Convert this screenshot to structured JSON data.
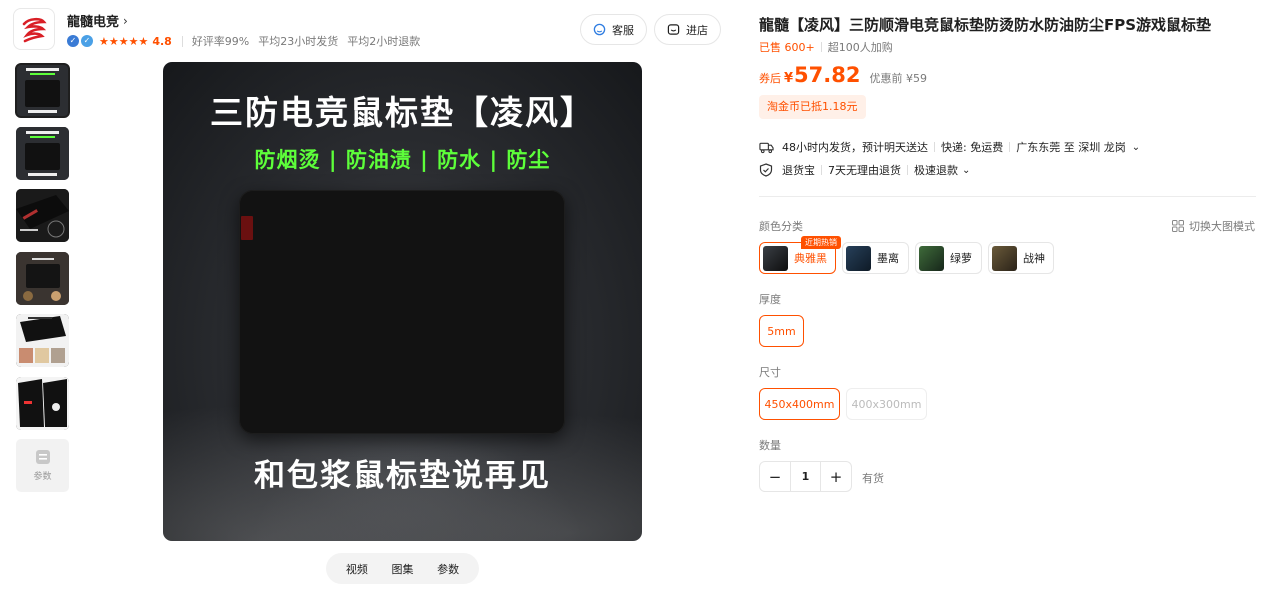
{
  "shop": {
    "name": "龍髓电竞",
    "rating": "4.8",
    "good_rate": "好评率99%",
    "ship_time": "平均23小时发货",
    "refund_time": "平均2小时退款",
    "service_label": "客服",
    "store_label": "进店"
  },
  "gallery": {
    "params_label": "参数",
    "main_title": "三防电竞鼠标垫【凌风】",
    "main_subtitle": "防烟烫 | 防油渍 | 防水 | 防尘",
    "main_bottom": "和包浆鼠标垫说再见",
    "tabs": [
      "视频",
      "图集",
      "参数"
    ]
  },
  "product": {
    "title": "龍髓【凌风】三防顺滑电竞鼠标垫防烫防水防油防尘FPS游戏鼠标垫",
    "sold": "已售 600+",
    "cart_count": "超100人加购",
    "price_prefix": "券后",
    "currency": "¥",
    "price": "57.82",
    "original_price": "优惠前 ¥59",
    "coin_text": "淘金币已抵1.18元"
  },
  "shipping": {
    "promise": "48小时内发货，预计明天送达",
    "fee": "快递: 免运费",
    "route": "广东东莞 至 深圳 龙岗",
    "return_insurance": "退货宝",
    "no_reason": "7天无理由退货",
    "fast_refund": "极速退款"
  },
  "options": {
    "color_label": "颜色分类",
    "switch_mode": "切换大图模式",
    "hot_tag": "近期热销",
    "colors": [
      "典雅黑",
      "墨离",
      "绿萝",
      "战神"
    ],
    "thickness_label": "厚度",
    "thickness": [
      "5mm"
    ],
    "size_label": "尺寸",
    "sizes": [
      "450x400mm",
      "400x300mm"
    ],
    "quantity_label": "数量",
    "quantity": "1",
    "stock": "有货"
  },
  "colors": {
    "accent": "#ff5000",
    "text": "#1f1f1f",
    "muted": "#7a7a7a"
  }
}
